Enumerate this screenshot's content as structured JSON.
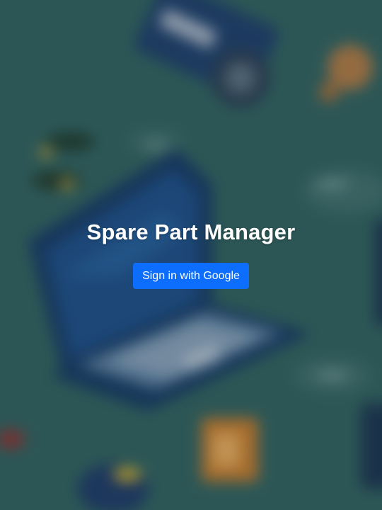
{
  "app": {
    "title": "Spare Part Manager"
  },
  "auth": {
    "signin_label": "Sign in with Google"
  },
  "colors": {
    "background": "#2f5f60",
    "primary_button": "#0d6efd",
    "title_text": "#ffffff"
  },
  "background_image": {
    "description_icon": "blurred-isometric-laptop-and-parts-illustration"
  }
}
